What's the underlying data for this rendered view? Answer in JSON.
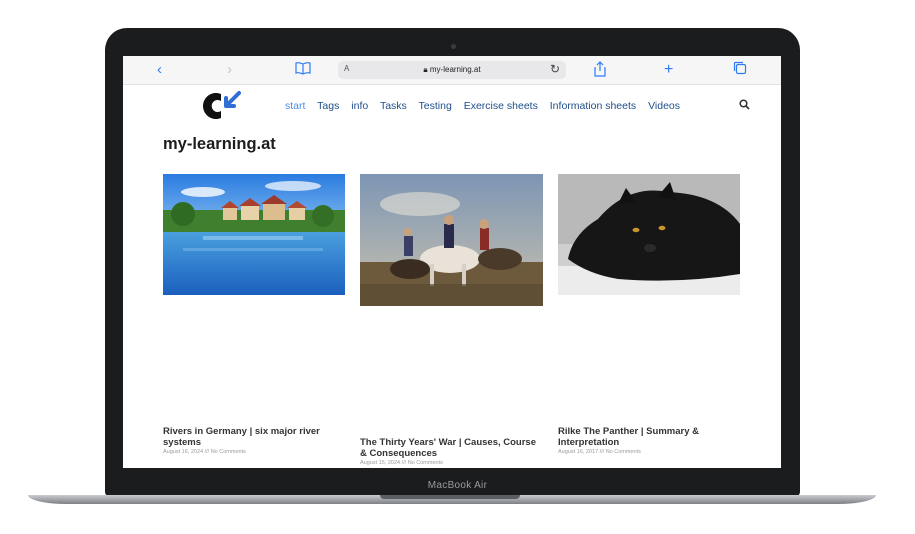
{
  "device": {
    "label": "MacBook Air"
  },
  "browser": {
    "back_icon": "chevron-left-icon",
    "forward_icon": "chevron-right-icon",
    "bookmarks_icon": "book-icon",
    "reader_label": "A",
    "url": "my-learning.at",
    "reload_icon": "reload-icon",
    "share_icon": "share-icon",
    "new_tab_icon": "plus-icon",
    "tabs_icon": "tabs-icon",
    "accent": "#2f7bf5"
  },
  "site": {
    "title": "my-learning.at",
    "nav": [
      "start",
      "Tags",
      "info",
      "Tasks",
      "Testing",
      "Exercise sheets",
      "Information sheets",
      "Videos"
    ],
    "active_nav": "start",
    "nav_color": "#1f4f8a",
    "active_color": "#4b8ee8"
  },
  "posts": [
    {
      "title_line1": "Rivers in Germany | six major river",
      "title_line2": "systems",
      "meta": "August 16, 2024 /// No Comments",
      "image": "river-town-photo"
    },
    {
      "title_line1": "The Thirty Years' War | Causes, Course",
      "title_line2": "& Consequences",
      "meta": "August 15, 2024 /// No Comments",
      "image": "battle-painting"
    },
    {
      "title_line1": "Rilke The Panther | Summary &",
      "title_line2": "Interpretation",
      "meta": "August 16, 2017 /// No Comments",
      "image": "black-panther-photo"
    }
  ]
}
